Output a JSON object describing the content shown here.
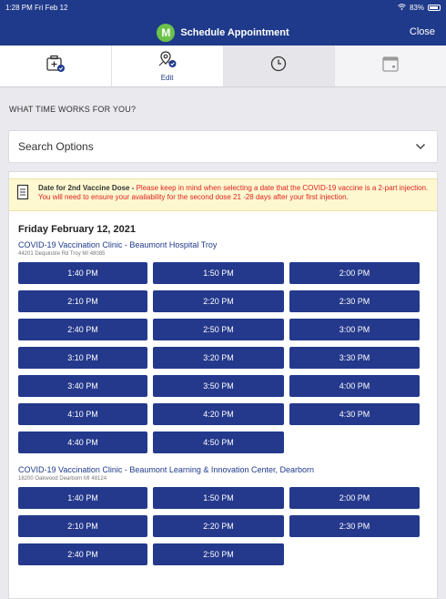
{
  "status": {
    "time": "1:28 PM  Fri Feb 12",
    "battery": "83%"
  },
  "header": {
    "logo_letter": "M",
    "title": "Schedule Appointment",
    "close": "Close"
  },
  "tabs": [
    {
      "icon": "medical-kit-icon",
      "label": ""
    },
    {
      "icon": "location-pin-icon",
      "label": "Edit"
    },
    {
      "icon": "clock-icon",
      "label": ""
    },
    {
      "icon": "calendar-icon",
      "label": ""
    }
  ],
  "prompt": "WHAT TIME WORKS FOR YOU?",
  "search": {
    "label": "Search Options"
  },
  "notice": {
    "bold": "Date for 2nd Vaccine Dose -",
    "text": " Please keep in mind when selecting a date that the COVID-19 vaccine is a 2-part injection. You will need to ensure your availability for the second dose 21 -28 days after your first injection."
  },
  "date": "Friday February 12, 2021",
  "clinics": [
    {
      "name": "COVID-19 Vaccination Clinic - Beaumont Hospital Troy",
      "address": "44201 Dequindre Rd Troy MI 48085",
      "slots": [
        "1:40 PM",
        "1:50 PM",
        "2:00 PM",
        "2:10 PM",
        "2:20 PM",
        "2:30 PM",
        "2:40 PM",
        "2:50 PM",
        "3:00 PM",
        "3:10 PM",
        "3:20 PM",
        "3:30 PM",
        "3:40 PM",
        "3:50 PM",
        "4:00 PM",
        "4:10 PM",
        "4:20 PM",
        "4:30 PM",
        "4:40 PM",
        "4:50 PM"
      ]
    },
    {
      "name": "COVID-19 Vaccination Clinic - Beaumont Learning & Innovation Center, Dearborn",
      "address": "18200 Oakwood Dearborn MI 48124",
      "slots": [
        "1:40 PM",
        "1:50 PM",
        "2:00 PM",
        "2:10 PM",
        "2:20 PM",
        "2:30 PM",
        "2:40 PM",
        "2:50 PM"
      ]
    }
  ]
}
